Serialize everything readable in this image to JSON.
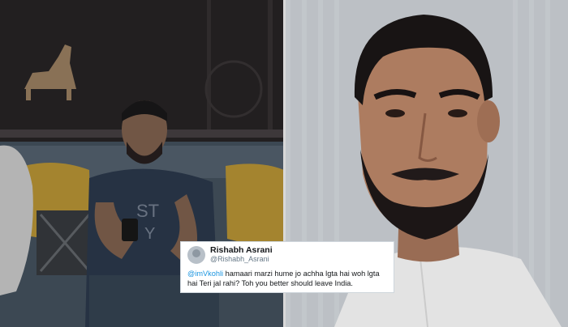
{
  "tweet": {
    "display_name": "Rishabh Asrani",
    "handle": "@Rishabh_Asrani",
    "mention": "@imVkohli",
    "text": " hamaari marzi hume jo achha lgta hai woh lgta hai Teri jal rahi? Toh you better should leave India."
  },
  "left_photo": {
    "shirt_text_1": "ST",
    "shirt_text_2": "Y"
  }
}
